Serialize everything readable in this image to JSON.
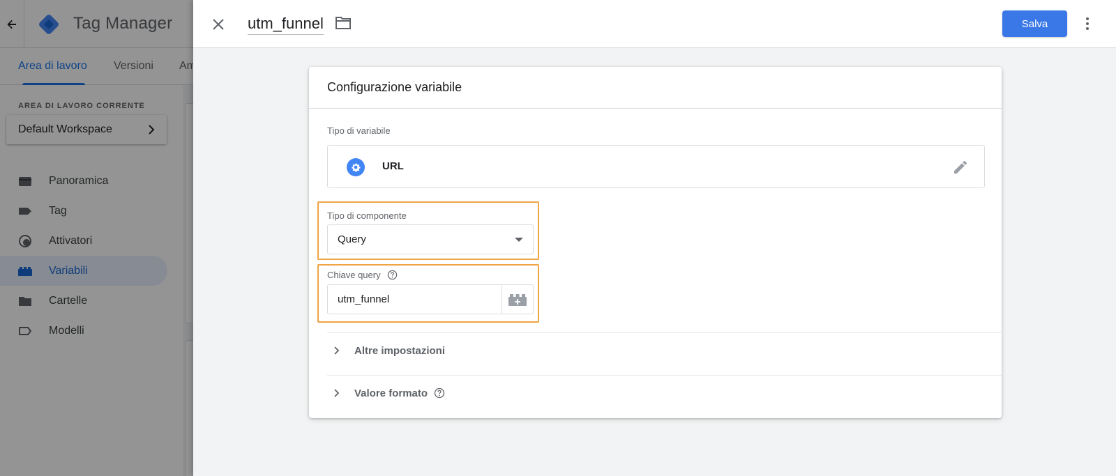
{
  "app": {
    "product_name": "Tag Manager",
    "tabs": [
      {
        "label": "Area di lavoro",
        "active": true
      },
      {
        "label": "Versioni",
        "active": false
      },
      {
        "label": "Am",
        "active": false
      }
    ],
    "workspace_heading": "AREA DI LAVORO CORRENTE",
    "workspace_name": "Default Workspace",
    "nav": [
      {
        "label": "Panoramica",
        "icon": "briefcase-icon",
        "active": false
      },
      {
        "label": "Tag",
        "icon": "tag-icon",
        "active": false
      },
      {
        "label": "Attivatori",
        "icon": "trigger-icon",
        "active": false
      },
      {
        "label": "Variabili",
        "icon": "variables-icon",
        "active": true
      },
      {
        "label": "Cartelle",
        "icon": "folder-icon",
        "active": false
      },
      {
        "label": "Modelli",
        "icon": "template-icon",
        "active": false
      }
    ]
  },
  "editor": {
    "variable_name": "utm_funnel",
    "save_label": "Salva",
    "card_title": "Configurazione variabile",
    "variable_type_label": "Tipo di variabile",
    "variable_type_value": "URL",
    "component_type_label": "Tipo di componente",
    "component_type_value": "Query",
    "query_key_label": "Chiave query",
    "query_key_value": "utm_funnel",
    "more_settings_label": "Altre impostazioni",
    "format_value_label": "Valore formato"
  },
  "colors": {
    "accent": "#1a73e8",
    "save_button": "#3b78e7",
    "highlight": "#f0a443"
  }
}
